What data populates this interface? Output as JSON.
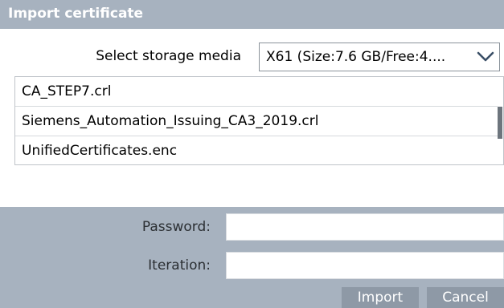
{
  "dialog": {
    "title": "Import certificate"
  },
  "storage": {
    "label": "Select storage media",
    "selected": "X61 (Size:7.6 GB/Free:4....",
    "dropdown_icon": "chevron-down-icon"
  },
  "files": [
    "CA_STEP7.crl",
    "Siemens_Automation_Issuing_CA3_2019.crl",
    "UnifiedCertificates.enc"
  ],
  "password": {
    "label": "Password:",
    "value": ""
  },
  "iteration": {
    "label": "Iteration:",
    "value": ""
  },
  "buttons": {
    "import": "Import",
    "cancel": "Cancel"
  },
  "colors": {
    "header_bg": "#a7b2bf",
    "button_bg": "#8e99a6",
    "text": "#000000"
  }
}
